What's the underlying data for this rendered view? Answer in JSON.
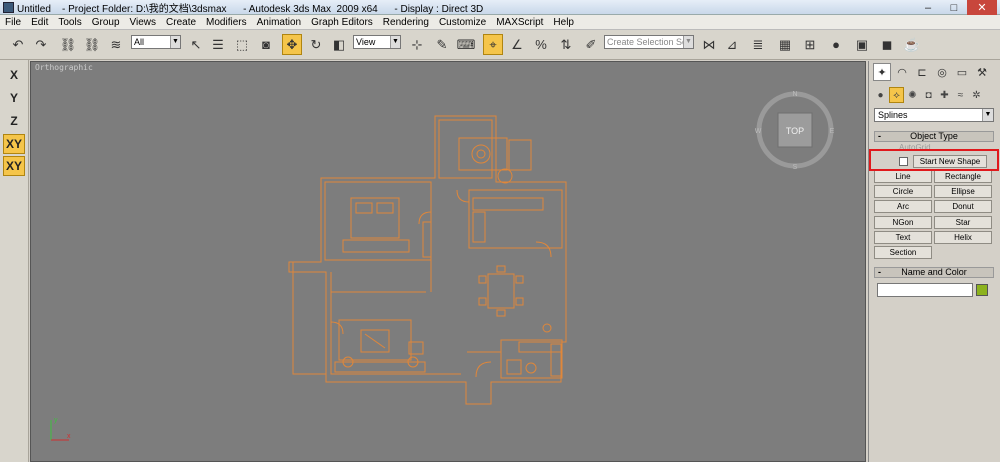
{
  "titlebar": {
    "text": "Untitled    - Project Folder: D:\\我的文档\\3dsmax      - Autodesk 3ds Max  2009 x64      - Display : Direct 3D"
  },
  "menu": [
    "File",
    "Edit",
    "Tools",
    "Group",
    "Views",
    "Create",
    "Modifiers",
    "Animation",
    "Graph Editors",
    "Rendering",
    "Customize",
    "MAXScript",
    "Help"
  ],
  "toolbar": {
    "selection_filter": "All",
    "ref_coord": "View",
    "selection_set_placeholder": "Create Selection Set"
  },
  "axis_buttons": [
    "X",
    "Y",
    "Z",
    "XY",
    "XY"
  ],
  "viewport": {
    "label": "Orthographic",
    "viewcube_label": "TOP",
    "compass": [
      "N",
      "S",
      "E",
      "W"
    ],
    "linecolor": "#e0873a"
  },
  "command_panel": {
    "category_dropdown": "Splines",
    "object_type": {
      "title": "Object Type",
      "autogrid_label": "AutoGrid",
      "start_new_shape": "Start New Shape",
      "buttons": [
        "Line",
        "Rectangle",
        "Circle",
        "Ellipse",
        "Arc",
        "Donut",
        "NGon",
        "Star",
        "Text",
        "Helix",
        "Section"
      ]
    },
    "name_and_color": {
      "title": "Name and Color",
      "name_value": "",
      "color": "#8cb21d"
    }
  },
  "colors": {
    "highlight_box": "#e0191c",
    "active_tool": "#f5c54a"
  }
}
